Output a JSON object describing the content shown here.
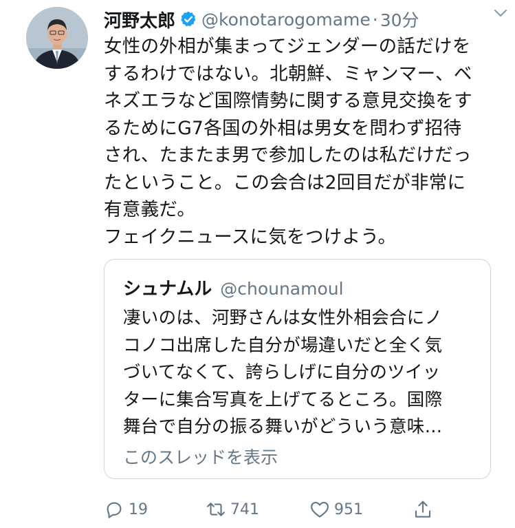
{
  "tweet": {
    "author": {
      "display_name": "河野太郎",
      "handle": "@konotarogomame",
      "verified": true,
      "avatar_icon": "avatar-photo"
    },
    "separator": "·",
    "time": "30分",
    "text_lines": [
      "女性の外相が集まってジェンダーの話だけを",
      "するわけではない。北朝鮮、ミャンマー、ベ",
      "ネズエラなど国際情勢に関する意見交換をす",
      "るためにG7各国の外相は男女を問わず招待",
      "され、たまたま男で参加したのは私だけだっ",
      "たということ。この会合は2回目だが非常に",
      "有意義だ。",
      "フェイクニュースに気をつけよう。"
    ],
    "quote": {
      "display_name": "シュナムル",
      "handle": "@chounamoul",
      "text_lines": [
        "凄いのは、河野さんは女性外相会合にノ",
        "コノコ出席した自分が場違いだと全く気",
        "づいてなくて、誇らしげに自分のツイッ",
        "ターに集合写真を上げてるところ。国際",
        "舞台で自分の振る舞いがどういう意味…"
      ],
      "show_thread": "このスレッドを表示"
    },
    "actions": {
      "reply_count": "19",
      "retweet_count": "741",
      "like_count": "951"
    }
  },
  "colors": {
    "text": "#14171a",
    "muted": "#657786",
    "verified": "#1da1f2",
    "border": "#ccd6dd"
  }
}
